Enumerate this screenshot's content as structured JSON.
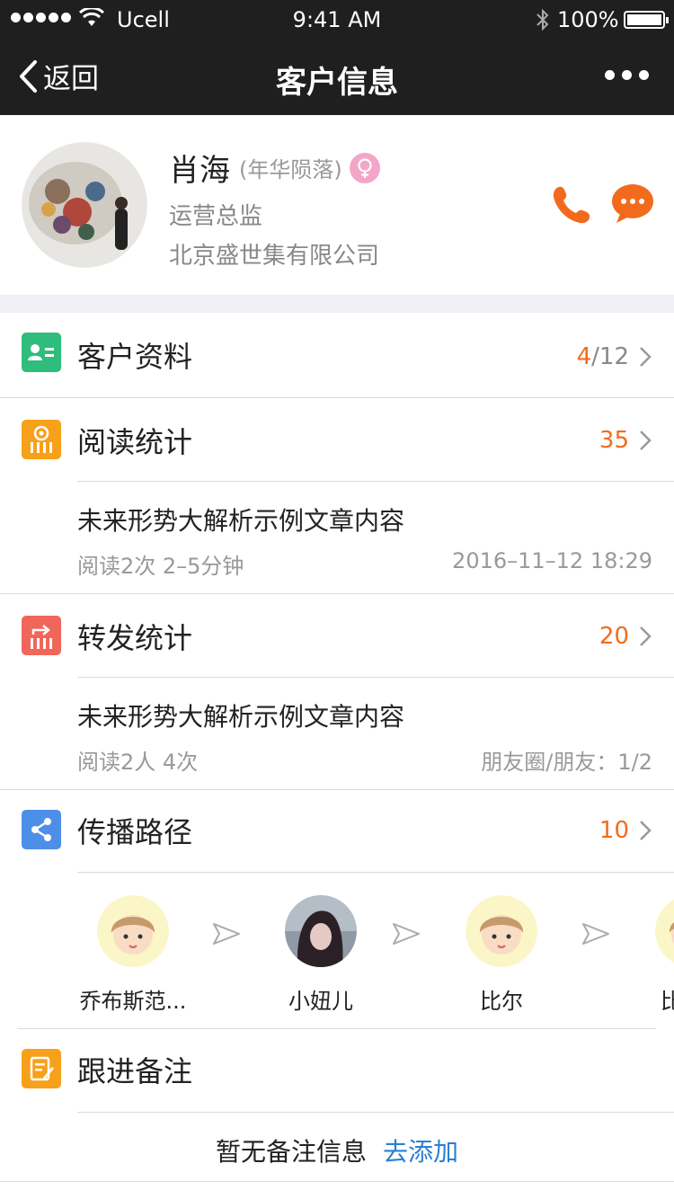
{
  "status": {
    "carrier": "Ucell",
    "time": "9:41 AM",
    "battery": "100%",
    "battery_level": 1.0
  },
  "nav": {
    "back_label": "返回",
    "title": "客户信息"
  },
  "profile": {
    "name": "肖海",
    "nickname": "(年华陨落)",
    "title": "运营总监",
    "company": "北京盛世集有限公司"
  },
  "sections": {
    "customer_info": {
      "title": "客户资料",
      "count": "4",
      "total": "/12"
    },
    "read_stats": {
      "title": "阅读统计",
      "count": "35",
      "article": "未来形势大解析示例文章内容",
      "meta_left": "阅读2次   2–5分钟",
      "meta_right": "2016–11–12 18:29"
    },
    "share_stats": {
      "title": "转发统计",
      "count": "20",
      "article": "未来形势大解析示例文章内容",
      "meta_left": "阅读2人   4次",
      "meta_right": "朋友圈/朋友：1/2"
    },
    "spread_path": {
      "title": "传播路径",
      "count": "10",
      "people": [
        "乔布斯范...",
        "小妞儿",
        "比尔",
        "比"
      ]
    },
    "followup": {
      "title": "跟进备注",
      "empty": "暂无备注信息",
      "add": "去添加"
    }
  },
  "colors": {
    "accent": "#f26b1d",
    "link": "#2a7fd4",
    "green": "#2ebd7b",
    "yellow": "#f7a01a",
    "red": "#f0665a",
    "blue": "#4d8fe8"
  }
}
